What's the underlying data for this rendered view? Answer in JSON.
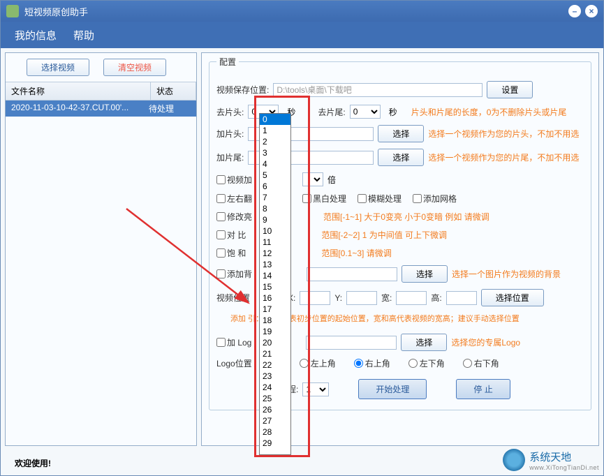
{
  "title": "短视频原创助手",
  "menu": {
    "info": "我的信息",
    "help": "帮助"
  },
  "leftPanel": {
    "selectBtn": "选择视频",
    "clearBtn": "清空视频",
    "colName": "文件名称",
    "colStatus": "状态",
    "rows": [
      {
        "name": "2020-11-03-10-42-37.CUT.00'...",
        "status": "待处理"
      }
    ]
  },
  "config": {
    "groupTitle": "配置",
    "saveLoc": "视频保存位置:",
    "savePath": "D:\\tools\\桌面\\下载吧",
    "setBtn": "设置",
    "cutHead": "去片头:",
    "cutHeadVal": "0",
    "sec": "秒",
    "cutTail": "去片尾:",
    "cutTailVal": "0",
    "cutHint": "片头和片尾的长度，0为不删除片头或片尾",
    "addHead": "加片头:",
    "addTail": "加片尾:",
    "selectBtn": "选择",
    "addHeadHint": "选择一个视频作为您的片头，不加不用选",
    "addTailHint": "选择一个视频作为您的片尾，不加不用选",
    "speedChk": "视频加",
    "speedUnit": "倍",
    "flipChk": "左右翻",
    "bwChk": "黑白处理",
    "blurChk": "模糊处理",
    "gridChk": "添加网格",
    "brightChk": "修改亮",
    "brightHint": "范围[-1~1]   大于0变亮 小于0变暗  例如 请微调",
    "contrastChk": "对 比",
    "contrastHint": "范围[-2~2]  1 为中间值  可上下微调",
    "satChk": "饱  和",
    "satHint": "范围[0.1~3]   请微调",
    "bgChk": "添加背",
    "bgHint": "选择一个图片作为视频的背景",
    "posLabel": "视频位置",
    "posX": "X:",
    "posY": "Y:",
    "posW": "宽:",
    "posH": "高:",
    "posBtn": "选择位置",
    "posHint": "添加      引：X和Y代表初步位置的起始位置，宽和高代表视频的宽高；建议手动选择位置",
    "logoChk": "加 Log",
    "logoHint": "选择您的专属Logo",
    "logoPosLabel": "Logo位置",
    "radioTL": "左上角",
    "radioTR": "右上角",
    "radioBL": "左下角",
    "radioBR": "右下角",
    "threadLabel": "线程:",
    "threadVal": "1",
    "startBtn": "开始处理",
    "stopBtn": "停   止"
  },
  "dropdown": {
    "selected": 0,
    "options": [
      "0",
      "1",
      "2",
      "3",
      "4",
      "5",
      "6",
      "7",
      "8",
      "9",
      "10",
      "11",
      "12",
      "13",
      "14",
      "15",
      "16",
      "17",
      "18",
      "19",
      "20",
      "21",
      "22",
      "23",
      "24",
      "25",
      "26",
      "27",
      "28",
      "29"
    ]
  },
  "statusbar": "欢迎使用!",
  "watermark": {
    "cn": "系统天地",
    "en": "www.XiTongTianDi.net"
  }
}
